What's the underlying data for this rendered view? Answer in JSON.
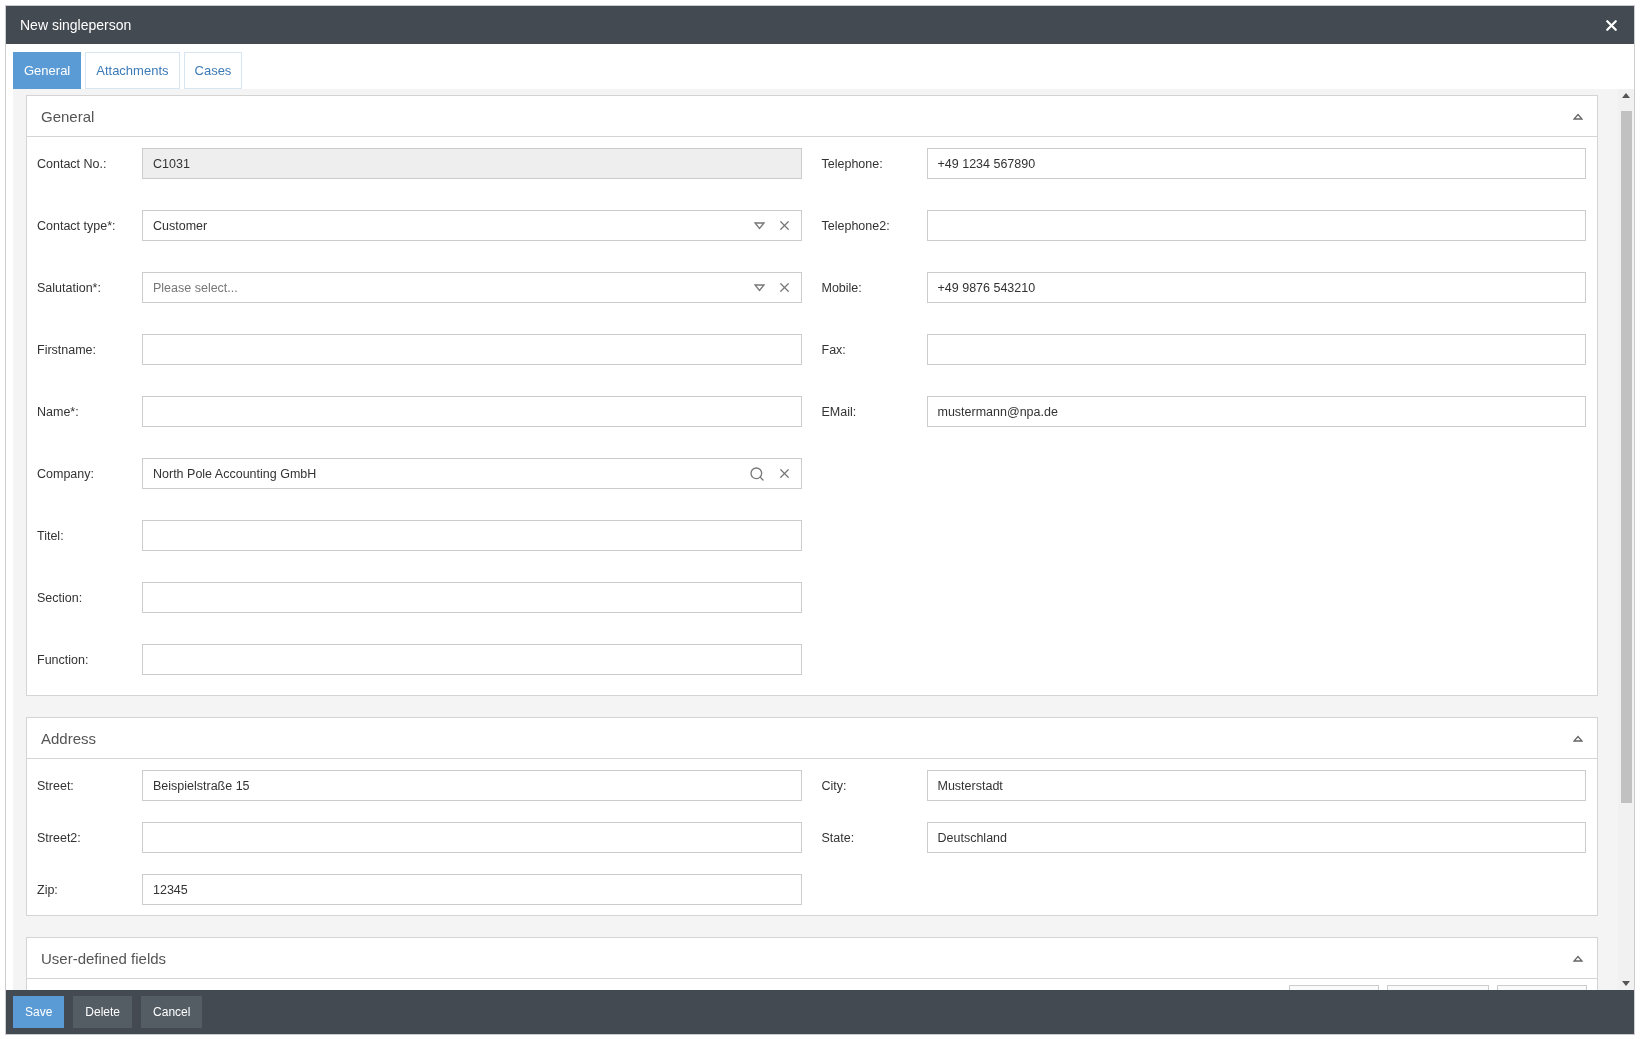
{
  "window": {
    "title": "New singleperson"
  },
  "tabs": [
    {
      "label": "General",
      "selected": true
    },
    {
      "label": "Attachments",
      "selected": false
    },
    {
      "label": "Cases",
      "selected": false
    }
  ],
  "sections": [
    {
      "title": "General",
      "expanded": true,
      "columns": [
        [
          {
            "label": "Contact No.:",
            "kind": "readonly",
            "value": "C1031"
          },
          {
            "label": "Contact type*:",
            "kind": "select",
            "value": "Customer"
          },
          {
            "label": "Salutation*:",
            "kind": "select",
            "placeholder": "Please select..."
          },
          {
            "label": "Firstname:",
            "kind": "text"
          },
          {
            "label": "Name*:",
            "kind": "text"
          },
          {
            "label": "Company:",
            "kind": "lookup",
            "value": "North Pole Accounting GmbH"
          },
          {
            "label": "Titel:",
            "kind": "text"
          },
          {
            "label": "Section:",
            "kind": "text"
          },
          {
            "label": "Function:",
            "kind": "text"
          }
        ],
        [
          {
            "label": "Telephone:",
            "kind": "text",
            "value": "+49 1234 567890"
          },
          {
            "label": "Telephone2:",
            "kind": "text"
          },
          {
            "label": "Mobile:",
            "kind": "text",
            "value": "+49 9876 543210"
          },
          {
            "label": "Fax:",
            "kind": "text"
          },
          {
            "label": "EMail:",
            "kind": "text",
            "value": "mustermann@npa.de"
          }
        ]
      ]
    },
    {
      "title": "Address",
      "expanded": true,
      "columns": [
        [
          {
            "label": "Street:",
            "kind": "text",
            "value": "Beispielstraße 15"
          },
          {
            "label": "Street2:",
            "kind": "text"
          },
          {
            "label": "Zip:",
            "kind": "text",
            "value": "12345"
          }
        ],
        [
          {
            "label": "City:",
            "kind": "text",
            "value": "Musterstadt"
          },
          {
            "label": "State:",
            "kind": "text",
            "value": "Deutschland"
          }
        ]
      ]
    },
    {
      "title": "User-defined fields",
      "expanded": true
    }
  ],
  "buttons": [
    {
      "label": "Save",
      "primary": true
    },
    {
      "label": "Delete",
      "primary": false
    },
    {
      "label": "Cancel",
      "primary": false
    }
  ]
}
